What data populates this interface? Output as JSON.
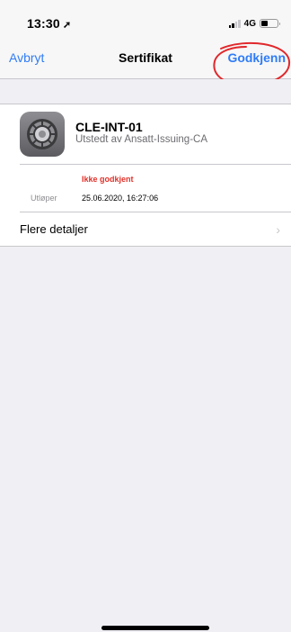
{
  "status_bar": {
    "time": "13:30",
    "location_icon": "location-arrow-icon",
    "network": "4G",
    "signal_icon": "cellular-signal-icon",
    "battery_icon": "battery-icon"
  },
  "nav": {
    "cancel_label": "Avbryt",
    "title": "Sertifikat",
    "approve_label": "Godkjenn",
    "annotation_color": "#e0282c"
  },
  "certificate": {
    "icon": "settings-gear-icon",
    "name": "CLE-INT-01",
    "issuer": "Utstedt av Ansatt-Issuing-CA",
    "status": "Ikke godkjent",
    "expiry_label": "Utløper",
    "expiry_value": "25.06.2020, 16:27:06"
  },
  "more_details": {
    "label": "Flere detaljer",
    "chevron": "›"
  },
  "colors": {
    "accent": "#2f7cf6",
    "status_red": "#e0322a",
    "background": "#efeff4"
  }
}
